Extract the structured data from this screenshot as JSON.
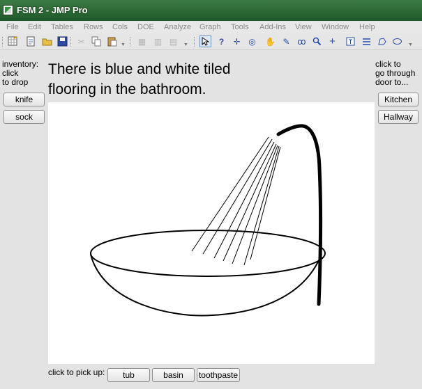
{
  "window": {
    "title": "FSM 2 - JMP Pro"
  },
  "menu": [
    "File",
    "Edit",
    "Tables",
    "Rows",
    "Cols",
    "DOE",
    "Analyze",
    "Graph",
    "Tools",
    "Add-Ins",
    "View",
    "Window",
    "Help"
  ],
  "toolbar_icons": [
    "new-data-table-icon",
    "new-script-icon",
    "open-icon",
    "save-icon",
    "cut-icon",
    "copy-icon",
    "paste-icon",
    "data-table-icon",
    "table-grid-icon",
    "table-report-icon",
    "arrow-tool-icon",
    "help-tool-icon",
    "crosshair-tool-icon",
    "lasso-target-icon",
    "grabber-hand-icon",
    "brush-tool-icon",
    "lasso-tool-icon",
    "magnifier-icon",
    "plus-tool-icon",
    "annotate-icon",
    "line-tool-icon",
    "polygon-tool-icon",
    "ellipse-tool-icon"
  ],
  "inventory": {
    "label": "inventory:\n  click\nto drop",
    "items": [
      "knife",
      "sock"
    ]
  },
  "doors": {
    "label": "click to\ngo through\ndoor to...",
    "items": [
      "Kitchen",
      "Hallway"
    ]
  },
  "description": "There is blue and white tiled flooring in the bathroom.",
  "pickup": {
    "label": "click to pick up:",
    "items": [
      "tub",
      "basin",
      "toothpaste"
    ]
  },
  "colors": {
    "titlebar": "#2e6b38",
    "background": "#e3e3e3",
    "canvas": "#ffffff"
  }
}
